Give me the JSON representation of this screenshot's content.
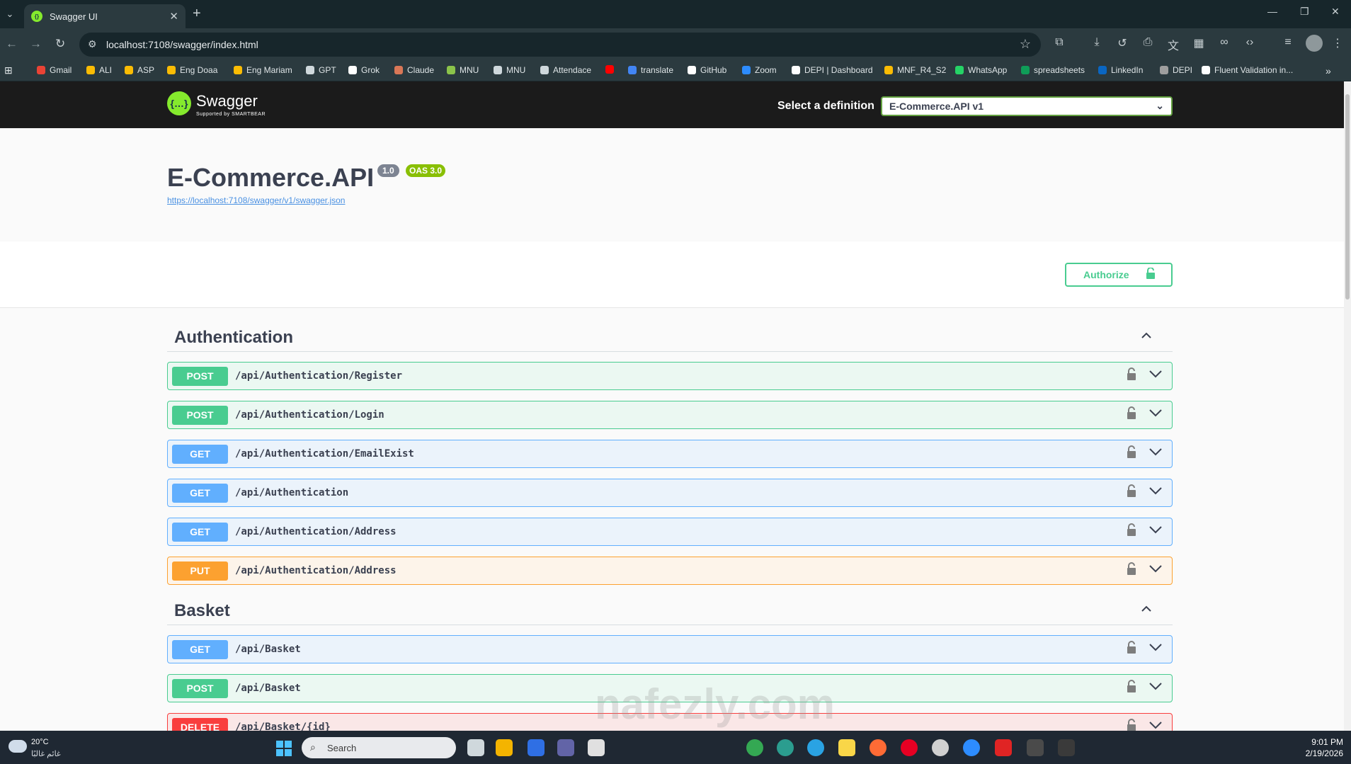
{
  "browser": {
    "tab_title": "Swagger UI",
    "url": "localhost:7108/swagger/index.html",
    "bookmarks": [
      {
        "label": "Gmail",
        "color": "#ea4335"
      },
      {
        "label": "ALI",
        "color": "#fbbc04"
      },
      {
        "label": "ASP",
        "color": "#fbbc04"
      },
      {
        "label": "Eng Doaa",
        "color": "#fbbc04"
      },
      {
        "label": "Eng Mariam",
        "color": "#fbbc04"
      },
      {
        "label": "GPT",
        "color": "#cfd8dc"
      },
      {
        "label": "Grok",
        "color": "#ffffff"
      },
      {
        "label": "Claude",
        "color": "#d97757"
      },
      {
        "label": "MNU",
        "color": "#8bc34a"
      },
      {
        "label": "MNU",
        "color": "#cfd8dc"
      },
      {
        "label": "Attendace",
        "color": "#cfd8dc"
      },
      {
        "label": "",
        "color": "#ff0000"
      },
      {
        "label": "translate",
        "color": "#4285f4"
      },
      {
        "label": "GitHub",
        "color": "#ffffff"
      },
      {
        "label": "Zoom",
        "color": "#2d8cff"
      },
      {
        "label": "DEPI | Dashboard",
        "color": "#ffffff"
      },
      {
        "label": "MNF_R4_S2",
        "color": "#fbbc04"
      },
      {
        "label": "WhatsApp",
        "color": "#25d366"
      },
      {
        "label": "spreadsheets",
        "color": "#0f9d58"
      },
      {
        "label": "LinkedIn",
        "color": "#0a66c2"
      },
      {
        "label": "DEPI",
        "color": "#9e9e9e"
      },
      {
        "label": "Fluent Validation in...",
        "color": "#ffffff"
      }
    ]
  },
  "swagger": {
    "brand": "Swagger",
    "brand_sub": "Supported by SMARTBEAR",
    "select_label": "Select a definition",
    "selected_definition": "E-Commerce.API v1",
    "api_title": "E-Commerce.API",
    "version": "1.0",
    "oas": "OAS 3.0",
    "spec_url": "https://localhost:7108/swagger/v1/swagger.json",
    "authorize_label": "Authorize"
  },
  "tags": [
    {
      "name": "Authentication",
      "ops": [
        {
          "method": "POST",
          "path": "/api/Authentication/Register"
        },
        {
          "method": "POST",
          "path": "/api/Authentication/Login"
        },
        {
          "method": "GET",
          "path": "/api/Authentication/EmailExist"
        },
        {
          "method": "GET",
          "path": "/api/Authentication"
        },
        {
          "method": "GET",
          "path": "/api/Authentication/Address"
        },
        {
          "method": "PUT",
          "path": "/api/Authentication/Address"
        }
      ]
    },
    {
      "name": "Basket",
      "ops": [
        {
          "method": "GET",
          "path": "/api/Basket"
        },
        {
          "method": "POST",
          "path": "/api/Basket"
        },
        {
          "method": "DELETE",
          "path": "/api/Basket/{id}"
        }
      ]
    }
  ],
  "watermark": "nafezly.com",
  "taskbar": {
    "temperature": "20°C",
    "condition": "غائم غالبًا",
    "search_placeholder": "Search",
    "time": "9:01 PM",
    "date": "2/19/2026"
  },
  "colors": {
    "post": "#49cc90",
    "get": "#61affe",
    "put": "#fca130",
    "delete": "#f93e3e",
    "swagger_green": "#85ea2d"
  }
}
